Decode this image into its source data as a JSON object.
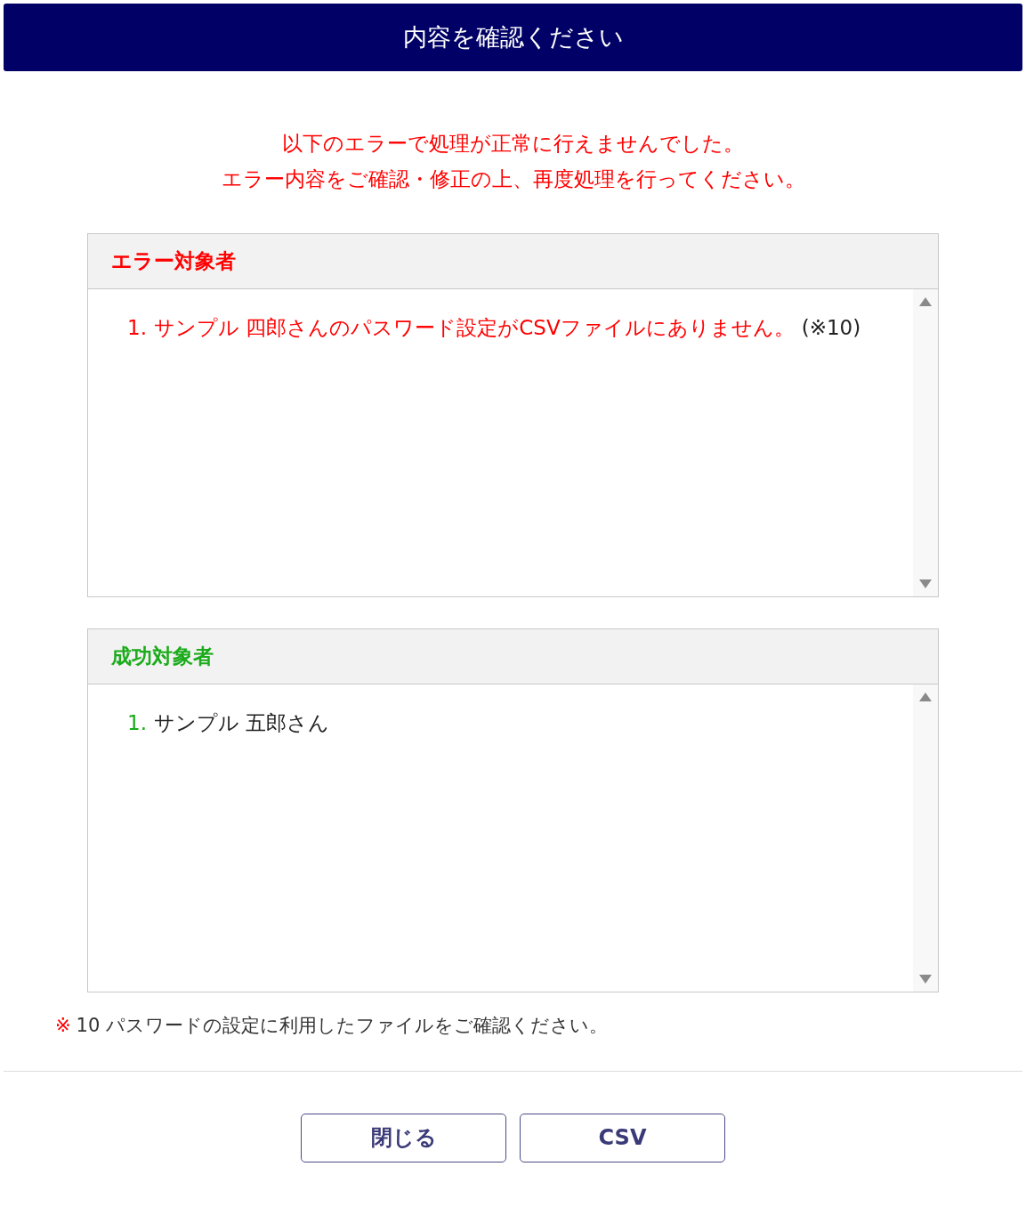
{
  "header": {
    "title": "内容を確認ください"
  },
  "message": [
    "以下のエラーで処理が正常に行えませんでした。",
    "エラー内容をご確認・修正の上、再度処理を行ってください。"
  ],
  "panels": [
    {
      "kind": "error",
      "title": "エラー対象者",
      "items": [
        {
          "number": "1.",
          "text": "サンプル 四郎さんのパスワード設定がCSVファイルにありません。",
          "note": "(※10)"
        }
      ]
    },
    {
      "kind": "success",
      "title": "成功対象者",
      "items": [
        {
          "number": "1.",
          "text": "サンプル 五郎さん"
        }
      ]
    }
  ],
  "footnote": {
    "mark": "※",
    "text": "10 パスワードの設定に利用したファイルをご確認ください。"
  },
  "buttons": [
    "閉じる",
    "CSV"
  ]
}
